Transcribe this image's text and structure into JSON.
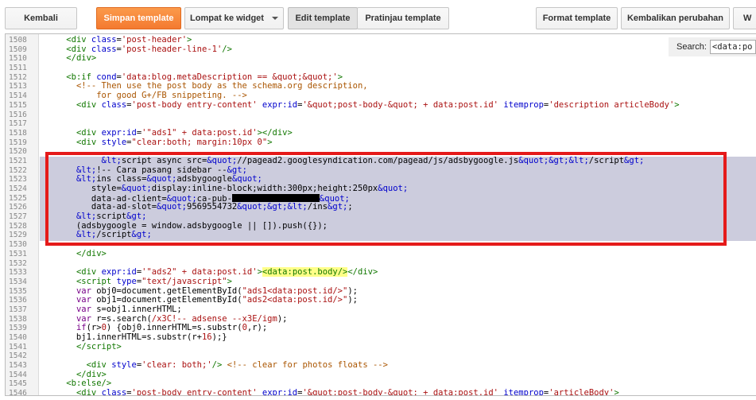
{
  "toolbar": {
    "back_label": "Kembali",
    "save_label": "Simpan template",
    "jump_label": "Lompat ke widget",
    "edit_label": "Edit template",
    "preview_label": "Pratinjau template",
    "format_label": "Format template",
    "revert_label": "Kembalikan perubahan",
    "extra_label": "W"
  },
  "search": {
    "label": "Search:",
    "value": "<data:po"
  },
  "colors": {
    "accent_orange": "#f47a30",
    "selection": "#ccccdd",
    "red_box": "#e51a1a"
  },
  "code_lines": [
    {
      "n": "1508",
      "html": "&nbsp;&nbsp;&nbsp;&nbsp;<span class='tag'>&lt;div</span> <span class='attr'>class</span>=<span class='str'>'post-header'</span><span class='tag'>&gt;</span>"
    },
    {
      "n": "1509",
      "html": "&nbsp;&nbsp;&nbsp;&nbsp;<span class='tag'>&lt;div</span> <span class='attr'>class</span>=<span class='str'>'post-header-line-1'</span><span class='tag'>/&gt;</span>"
    },
    {
      "n": "1510",
      "html": "&nbsp;&nbsp;&nbsp;&nbsp;<span class='tag'>&lt;/div&gt;</span>"
    },
    {
      "n": "1511",
      "html": ""
    },
    {
      "n": "1512",
      "html": "&nbsp;&nbsp;&nbsp;&nbsp;<span class='tag'>&lt;b:if</span> <span class='attr'>cond</span>=<span class='str'>'data:blog.metaDescription == &amp;quot;&amp;quot;'</span><span class='tag'>&gt;</span>"
    },
    {
      "n": "1513",
      "html": "&nbsp;&nbsp;&nbsp;&nbsp;&nbsp;&nbsp;<span class='cmt'>&lt;!-- Then use the post body as the schema.org description,</span>"
    },
    {
      "n": "1514",
      "html": "<span class='cmt'>&nbsp;&nbsp;&nbsp;&nbsp;&nbsp;&nbsp;&nbsp;&nbsp;&nbsp;&nbsp;for good G+/FB snippeting. --&gt;</span>"
    },
    {
      "n": "1515",
      "html": "&nbsp;&nbsp;&nbsp;&nbsp;&nbsp;&nbsp;<span class='tag'>&lt;div</span> <span class='attr'>class</span>=<span class='str'>'post-body entry-content'</span> <span class='attr'>expr:id</span>=<span class='str'>'&amp;quot;post-body-&amp;quot; + data:post.id'</span> <span class='attr'>itemprop</span>=<span class='str'>'description articleBody'</span><span class='tag'>&gt;</span>"
    },
    {
      "n": "1516",
      "html": ""
    },
    {
      "n": "1517",
      "html": ""
    },
    {
      "n": "1518",
      "html": "&nbsp;&nbsp;&nbsp;&nbsp;&nbsp;&nbsp;<span class='tag'>&lt;div</span> <span class='attr'>expr:id</span>=<span class='str'>'\"ads1\" + data:post.id'</span><span class='tag'>&gt;&lt;/div&gt;</span>"
    },
    {
      "n": "1519",
      "html": "&nbsp;&nbsp;&nbsp;&nbsp;&nbsp;&nbsp;<span class='tag'>&lt;div</span> <span class='attr'>style</span>=<span class='str'>\"clear:both; margin:10px 0\"</span><span class='tag'>&gt;</span>"
    },
    {
      "n": "1520",
      "html": ""
    },
    {
      "n": "1521",
      "html": "&nbsp;&nbsp;&nbsp;&nbsp;&nbsp;&nbsp;&nbsp;&nbsp;&nbsp;&nbsp;&nbsp;<span class='ent'>&amp;lt;</span>script async src=<span class='ent'>&amp;quot;</span>//pagead2.googlesyndication.com/pagead/js/adsbygoogle.js<span class='ent'>&amp;quot;&amp;gt;&amp;lt;</span>/script<span class='ent'>&amp;gt;</span>"
    },
    {
      "n": "1522",
      "html": "&nbsp;&nbsp;&nbsp;&nbsp;&nbsp;&nbsp;<span class='ent'>&amp;lt;</span>!-- Cara pasang sidebar --<span class='ent'>&amp;gt;</span>"
    },
    {
      "n": "1523",
      "html": "&nbsp;&nbsp;&nbsp;&nbsp;&nbsp;&nbsp;<span class='ent'>&amp;lt;</span>ins class=<span class='ent'>&amp;quot;</span>adsbygoogle<span class='ent'>&amp;quot;</span>"
    },
    {
      "n": "1524",
      "html": "&nbsp;&nbsp;&nbsp;&nbsp;&nbsp;&nbsp;&nbsp;&nbsp;&nbsp;style=<span class='ent'>&amp;quot;</span>display:inline-block;width:300px;height:250px<span class='ent'>&amp;quot;</span>"
    },
    {
      "n": "1525",
      "html": "&nbsp;&nbsp;&nbsp;&nbsp;&nbsp;&nbsp;&nbsp;&nbsp;&nbsp;data-ad-client=<span class='ent'>&amp;quot;</span>ca-pub-<span class='redact'></span><span class='ent'>&amp;quot;</span>"
    },
    {
      "n": "1526",
      "html": "&nbsp;&nbsp;&nbsp;&nbsp;&nbsp;&nbsp;&nbsp;&nbsp;&nbsp;data-ad-slot=<span class='ent'>&amp;quot;</span>9569554732<span class='ent'>&amp;quot;&amp;gt;&amp;lt;</span>/ins<span class='ent'>&amp;gt;</span>;"
    },
    {
      "n": "1527",
      "html": "&nbsp;&nbsp;&nbsp;&nbsp;&nbsp;&nbsp;<span class='ent'>&amp;lt;</span>script<span class='ent'>&amp;gt;</span>"
    },
    {
      "n": "1528",
      "html": "&nbsp;&nbsp;&nbsp;&nbsp;&nbsp;&nbsp;(adsbygoogle = window.adsbygoogle || []).push({});"
    },
    {
      "n": "1529",
      "html": "&nbsp;&nbsp;&nbsp;&nbsp;&nbsp;&nbsp;<span class='ent'>&amp;lt;</span>/script<span class='ent'>&amp;gt;</span>"
    },
    {
      "n": "1530",
      "html": ""
    },
    {
      "n": "1531",
      "html": "&nbsp;&nbsp;&nbsp;&nbsp;&nbsp;&nbsp;<span class='tag'>&lt;/div&gt;</span>"
    },
    {
      "n": "1532",
      "html": ""
    },
    {
      "n": "1533",
      "html": "&nbsp;&nbsp;&nbsp;&nbsp;&nbsp;&nbsp;<span class='tag'>&lt;div</span> <span class='attr'>expr:id</span>=<span class='str'>'\"ads2\" + data:post.id'</span><span class='tag'>&gt;</span><span class='hl'><span class='tag'>&lt;data:post.body/&gt;</span></span><span class='tag'>&lt;/div&gt;</span>"
    },
    {
      "n": "1534",
      "html": "&nbsp;&nbsp;&nbsp;&nbsp;&nbsp;&nbsp;<span class='tag'>&lt;script</span> <span class='attr'>type</span>=<span class='str'>\"text/javascript\"</span><span class='tag'>&gt;</span>"
    },
    {
      "n": "1535",
      "html": "&nbsp;&nbsp;&nbsp;&nbsp;&nbsp;&nbsp;<span class='kw'>var</span> obj0=document.getElementById(<span class='str'>\"ads1&lt;data:post.id/&gt;\"</span>);"
    },
    {
      "n": "1536",
      "html": "&nbsp;&nbsp;&nbsp;&nbsp;&nbsp;&nbsp;<span class='kw'>var</span> obj1=document.getElementById(<span class='str'>\"ads2&lt;data:post.id/&gt;\"</span>);"
    },
    {
      "n": "1537",
      "html": "&nbsp;&nbsp;&nbsp;&nbsp;&nbsp;&nbsp;<span class='kw'>var</span> s=obj1.innerHTML;"
    },
    {
      "n": "1538",
      "html": "&nbsp;&nbsp;&nbsp;&nbsp;&nbsp;&nbsp;<span class='kw'>var</span> r=s.search(<span class='str'>/x3C!-- adsense --x3E/igm</span>);"
    },
    {
      "n": "1539",
      "html": "&nbsp;&nbsp;&nbsp;&nbsp;&nbsp;&nbsp;<span class='kw'>if</span>(r&gt;<span class='str'>0</span>) {obj0.innerHTML=s.substr(<span class='str'>0</span>,r);"
    },
    {
      "n": "1540",
      "html": "&nbsp;&nbsp;&nbsp;&nbsp;&nbsp;&nbsp;bj1.innerHTML=s.substr(r+<span class='str'>16</span>);}"
    },
    {
      "n": "1541",
      "html": "&nbsp;&nbsp;&nbsp;&nbsp;&nbsp;&nbsp;<span class='tag'>&lt;/script&gt;</span>"
    },
    {
      "n": "1542",
      "html": ""
    },
    {
      "n": "1543",
      "html": "&nbsp;&nbsp;&nbsp;&nbsp;&nbsp;&nbsp;&nbsp;&nbsp;<span class='tag'>&lt;div</span> <span class='attr'>style</span>=<span class='str'>'clear: both;'</span><span class='tag'>/&gt;</span> <span class='cmt'>&lt;!-- clear for photos floats --&gt;</span>"
    },
    {
      "n": "1544",
      "html": "&nbsp;&nbsp;&nbsp;&nbsp;&nbsp;&nbsp;<span class='tag'>&lt;/div&gt;</span>"
    },
    {
      "n": "1545",
      "html": "&nbsp;&nbsp;&nbsp;&nbsp;<span class='tag'>&lt;b:else/&gt;</span>"
    },
    {
      "n": "1546",
      "html": "&nbsp;&nbsp;&nbsp;&nbsp;&nbsp;&nbsp;<span class='tag'>&lt;div</span> <span class='attr'>class</span>=<span class='str'>'post-body entry-content'</span> <span class='attr'>expr:id</span>=<span class='str'>'&amp;quot;post-body-&amp;quot; + data:post.id'</span> <span class='attr'>itemprop</span>=<span class='str'>'articleBody'</span><span class='tag'>&gt;</span>"
    }
  ]
}
